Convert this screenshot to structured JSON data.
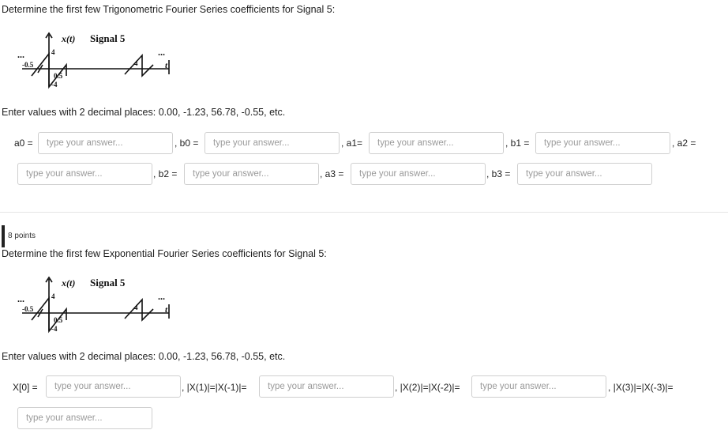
{
  "q1": {
    "prompt": "Determine the first few Trigonometric Fourier Series coefficients for Signal 5:",
    "figure": {
      "signal_label": "x(t)",
      "title": "Signal 5",
      "dots": "...",
      "t_label": "t",
      "tick_top": "4",
      "tick_neg_half": "-0.5",
      "tick_half": "0.5",
      "tick_bottom": "-4",
      "tick_right_4": "4"
    },
    "instructions": "Enter values with 2 decimal places: 0.00, -1.23, 56.78, -0.55, etc.",
    "fields": [
      {
        "label": "a0 =",
        "placeholder": "type your answer..."
      },
      {
        "label": ", b0 =",
        "placeholder": "type your answer..."
      },
      {
        "label": ", a1=",
        "placeholder": "type your answer..."
      },
      {
        "label": ", b1 =",
        "placeholder": "type your answer..."
      },
      {
        "label": ", a2 =",
        "placeholder": "type your answer..."
      },
      {
        "label": ", b2 =",
        "placeholder": "type your answer..."
      },
      {
        "label": ", a3 =",
        "placeholder": "type your answer..."
      },
      {
        "label": ", b3 =",
        "placeholder": "type your answer..."
      }
    ]
  },
  "q2": {
    "points": "8 points",
    "prompt": "Determine the first few Exponential Fourier Series coefficients for Signal 5:",
    "figure": {
      "signal_label": "x(t)",
      "title": "Signal 5",
      "dots": "...",
      "t_label": "t",
      "tick_top": "4",
      "tick_neg_half": "-0.5",
      "tick_half": "0.5",
      "tick_bottom": "-4",
      "tick_right_4": "4"
    },
    "instructions": "Enter values with 2 decimal places: 0.00, -1.23, 56.78, -0.55, etc.",
    "fields": [
      {
        "label": "X[0] =",
        "placeholder": "type your answer..."
      },
      {
        "label": ", |X(1)|=|X(-1)|=",
        "placeholder": "type your answer..."
      },
      {
        "label": ", |X(2)|=|X(-2)|=",
        "placeholder": "type your answer..."
      },
      {
        "label": ", |X(3)|=|X(-3)|=",
        "placeholder": "type your answer..."
      }
    ]
  }
}
